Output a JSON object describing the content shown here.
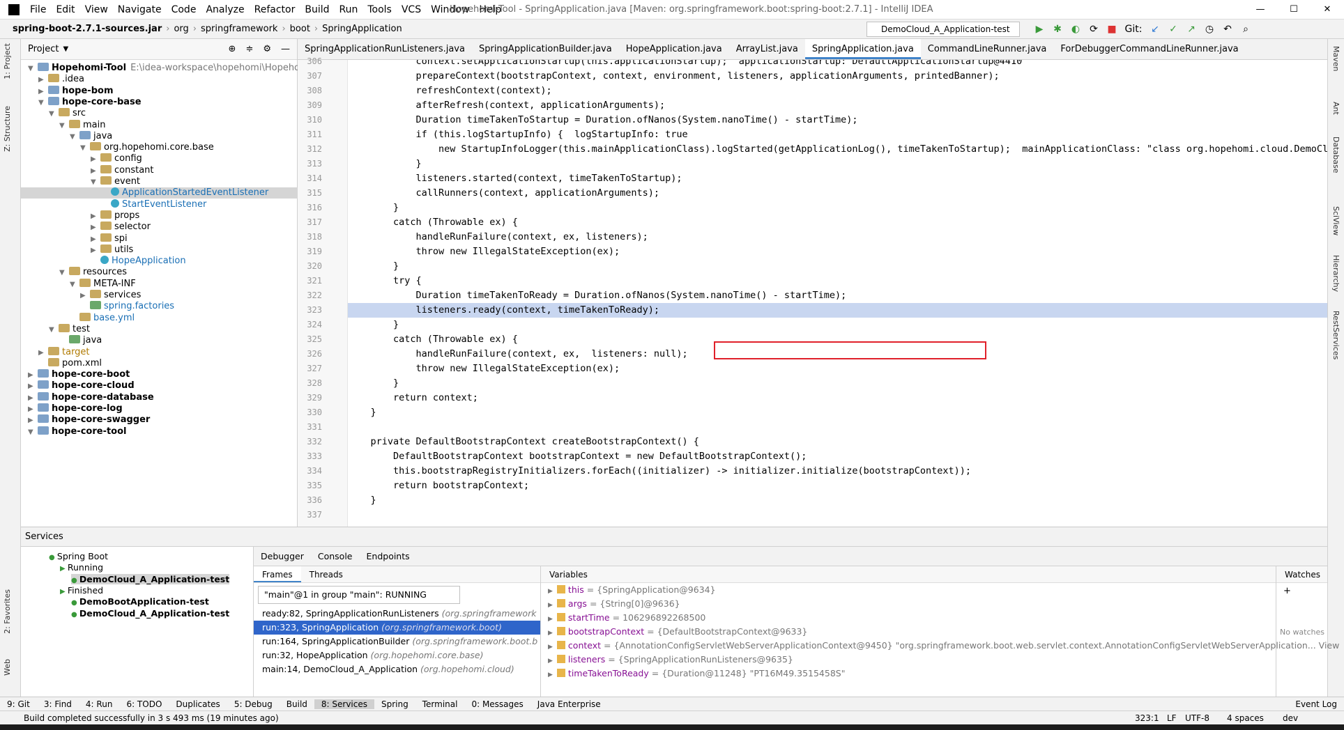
{
  "menu": [
    "File",
    "Edit",
    "View",
    "Navigate",
    "Code",
    "Analyze",
    "Refactor",
    "Build",
    "Run",
    "Tools",
    "VCS",
    "Window",
    "Help"
  ],
  "window_title": "Hopehomi-Tool - SpringApplication.java [Maven: org.springframework.boot:spring-boot:2.7.1] - IntelliJ IDEA",
  "breadcrumb": [
    "spring-boot-2.7.1-sources.jar",
    "org",
    "springframework",
    "boot",
    "SpringApplication"
  ],
  "run_config": "DemoCloud_A_Application-test",
  "git_label": "Git:",
  "left_tabs": [
    "1: Project",
    "Z: Structure",
    "2: Favorites",
    "Web"
  ],
  "right_tabs": [
    "Maven",
    "Ant",
    "Database",
    "SciView",
    "Hierarchy",
    "RestServices"
  ],
  "project": {
    "header": "Project",
    "nodes": [
      {
        "t": "Hopehomi-Tool",
        "extra": "E:\\idea-workspace\\hopehomi\\Hopehomi-To",
        "d": 0,
        "open": "v",
        "ic": "foldb",
        "b": true
      },
      {
        "t": ".idea",
        "d": 1,
        "open": ">",
        "ic": "fold"
      },
      {
        "t": "hope-bom",
        "d": 1,
        "open": ">",
        "ic": "foldb",
        "b": true
      },
      {
        "t": "hope-core-base",
        "d": 1,
        "open": "v",
        "ic": "foldb",
        "b": true
      },
      {
        "t": "src",
        "d": 2,
        "open": "v",
        "ic": "fold"
      },
      {
        "t": "main",
        "d": 3,
        "open": "v",
        "ic": "fold"
      },
      {
        "t": "java",
        "d": 4,
        "open": "v",
        "ic": "foldb"
      },
      {
        "t": "org.hopehomi.core.base",
        "d": 5,
        "open": "v",
        "ic": "fold"
      },
      {
        "t": "config",
        "d": 6,
        "open": ">",
        "ic": "fold"
      },
      {
        "t": "constant",
        "d": 6,
        "open": ">",
        "ic": "fold"
      },
      {
        "t": "event",
        "d": 6,
        "open": "v",
        "ic": "fold"
      },
      {
        "t": "ApplicationStartedEventListener",
        "d": 7,
        "open": "",
        "ic": "clsi",
        "c": "#1a6fb5",
        "sel": true
      },
      {
        "t": "StartEventListener",
        "d": 7,
        "open": "",
        "ic": "clsi",
        "c": "#1a6fb5"
      },
      {
        "t": "props",
        "d": 6,
        "open": ">",
        "ic": "fold"
      },
      {
        "t": "selector",
        "d": 6,
        "open": ">",
        "ic": "fold"
      },
      {
        "t": "spi",
        "d": 6,
        "open": ">",
        "ic": "fold"
      },
      {
        "t": "utils",
        "d": 6,
        "open": ">",
        "ic": "fold"
      },
      {
        "t": "HopeApplication",
        "d": 6,
        "open": "",
        "ic": "clsi",
        "c": "#1a6fb5"
      },
      {
        "t": "resources",
        "d": 3,
        "open": "v",
        "ic": "fold"
      },
      {
        "t": "META-INF",
        "d": 4,
        "open": "v",
        "ic": "fold"
      },
      {
        "t": "services",
        "d": 5,
        "open": ">",
        "ic": "fold"
      },
      {
        "t": "spring.factories",
        "d": 5,
        "open": "",
        "ic": "foldg",
        "c": "#1a6fb5"
      },
      {
        "t": "base.yml",
        "d": 4,
        "open": "",
        "ic": "fold",
        "c": "#1a6fb5"
      },
      {
        "t": "test",
        "d": 2,
        "open": "v",
        "ic": "fold"
      },
      {
        "t": "java",
        "d": 3,
        "open": "",
        "ic": "foldg"
      },
      {
        "t": "target",
        "d": 1,
        "open": ">",
        "ic": "fold",
        "c": "#b07a00"
      },
      {
        "t": "pom.xml",
        "d": 1,
        "open": "",
        "ic": "fold"
      },
      {
        "t": "hope-core-boot",
        "d": 0,
        "open": ">",
        "ic": "foldb",
        "b": true
      },
      {
        "t": "hope-core-cloud",
        "d": 0,
        "open": ">",
        "ic": "foldb",
        "b": true
      },
      {
        "t": "hope-core-database",
        "d": 0,
        "open": ">",
        "ic": "foldb",
        "b": true
      },
      {
        "t": "hope-core-log",
        "d": 0,
        "open": ">",
        "ic": "foldb",
        "b": true
      },
      {
        "t": "hope-core-swagger",
        "d": 0,
        "open": ">",
        "ic": "foldb",
        "b": true
      },
      {
        "t": "hope-core-tool",
        "d": 0,
        "open": "v",
        "ic": "foldb",
        "b": true
      }
    ]
  },
  "editor_tabs": [
    "SpringApplicationRunListeners.java",
    "SpringApplicationBuilder.java",
    "HopeApplication.java",
    "ArrayList.java",
    "SpringApplication.java",
    "CommandLineRunner.java",
    "ForDebuggerCommandLineRunner.java"
  ],
  "active_tab": 4,
  "code": [
    {
      "n": "306",
      "s": "            context.setApplicationStartup(this.applicationStartup);  applicationStartup: DefaultApplicationStartup@4410"
    },
    {
      "n": "307",
      "s": "            prepareContext(bootstrapContext, context, environment, listeners, applicationArguments, printedBanner);"
    },
    {
      "n": "308",
      "s": "            refreshContext(context);"
    },
    {
      "n": "309",
      "s": "            afterRefresh(context, applicationArguments);"
    },
    {
      "n": "310",
      "s": "            Duration timeTakenToStartup = Duration.ofNanos(System.nanoTime() - startTime);"
    },
    {
      "n": "311",
      "s": "            if (this.logStartupInfo) {  logStartupInfo: true"
    },
    {
      "n": "312",
      "s": "                new StartupInfoLogger(this.mainApplicationClass).logStarted(getApplicationLog(), timeTakenToStartup);  mainApplicationClass: \"class org.hopehomi.cloud.DemoCloud"
    },
    {
      "n": "313",
      "s": "            }"
    },
    {
      "n": "314",
      "s": "            listeners.started(context, timeTakenToStartup);"
    },
    {
      "n": "315",
      "s": "            callRunners(context, applicationArguments);"
    },
    {
      "n": "316",
      "s": "        }"
    },
    {
      "n": "317",
      "s": "        catch (Throwable ex) {"
    },
    {
      "n": "318",
      "s": "            handleRunFailure(context, ex, listeners);"
    },
    {
      "n": "319",
      "s": "            throw new IllegalStateException(ex);"
    },
    {
      "n": "320",
      "s": "        }"
    },
    {
      "n": "321",
      "s": "        try {"
    },
    {
      "n": "322",
      "s": "            Duration timeTakenToReady = Duration.ofNanos(System.nanoTime() - startTime);"
    },
    {
      "n": "323",
      "s": "            listeners.ready(context, timeTakenToReady);",
      "hl": true
    },
    {
      "n": "324",
      "s": "        }"
    },
    {
      "n": "325",
      "s": "        catch (Throwable ex) {"
    },
    {
      "n": "326",
      "s": "            handleRunFailure(context, ex,  listeners: null);"
    },
    {
      "n": "327",
      "s": "            throw new IllegalStateException(ex);"
    },
    {
      "n": "328",
      "s": "        }"
    },
    {
      "n": "329",
      "s": "        return context;"
    },
    {
      "n": "330",
      "s": "    }"
    },
    {
      "n": "331",
      "s": ""
    },
    {
      "n": "332",
      "s": "    private DefaultBootstrapContext createBootstrapContext() {"
    },
    {
      "n": "333",
      "s": "        DefaultBootstrapContext bootstrapContext = new DefaultBootstrapContext();"
    },
    {
      "n": "334",
      "s": "        this.bootstrapRegistryInitializers.forEach((initializer) -> initializer.initialize(bootstrapContext));"
    },
    {
      "n": "335",
      "s": "        return bootstrapContext;"
    },
    {
      "n": "336",
      "s": "    }"
    },
    {
      "n": "337",
      "s": ""
    }
  ],
  "services": {
    "header": "Services",
    "tree": [
      {
        "t": "Spring Boot",
        "d": 0,
        "b": false
      },
      {
        "t": "Running",
        "d": 1,
        "b": false
      },
      {
        "t": "DemoCloud_A_Application-test",
        "d": 2,
        "b": true,
        "sel": true
      },
      {
        "t": "Finished",
        "d": 1,
        "b": false
      },
      {
        "t": "DemoBootApplication-test",
        "d": 2,
        "b": true
      },
      {
        "t": "DemoCloud_A_Application-test",
        "d": 2,
        "b": true
      }
    ]
  },
  "debug_tabs": [
    "Debugger",
    "Console",
    "Endpoints"
  ],
  "frames_tabs": [
    "Frames",
    "Threads"
  ],
  "thread": "\"main\"@1 in group \"main\": RUNNING",
  "frames": [
    {
      "m": "ready:82, SpringApplicationRunListeners",
      "c": "(org.springframework"
    },
    {
      "m": "run:323, SpringApplication",
      "c": "(org.springframework.boot)",
      "sel": true
    },
    {
      "m": "run:164, SpringApplicationBuilder",
      "c": "(org.springframework.boot.b"
    },
    {
      "m": "run:32, HopeApplication",
      "c": "(org.hopehomi.core.base)"
    },
    {
      "m": "main:14, DemoCloud_A_Application",
      "c": "(org.hopehomi.cloud)"
    }
  ],
  "variables_header": "Variables",
  "variables": [
    {
      "n": "this",
      "v": "= {SpringApplication@9634}"
    },
    {
      "n": "args",
      "v": "= {String[0]@9636}"
    },
    {
      "n": "startTime",
      "v": "= 106296892268500"
    },
    {
      "n": "bootstrapContext",
      "v": "= {DefaultBootstrapContext@9633}"
    },
    {
      "n": "context",
      "v": "= {AnnotationConfigServletWebServerApplicationContext@9450} \"org.springframework.boot.web.servlet.context.AnnotationConfigServletWebServerApplication... View"
    },
    {
      "n": "listeners",
      "v": "= {SpringApplicationRunListeners@9635}"
    },
    {
      "n": "timeTakenToReady",
      "v": "= {Duration@11248} \"PT16M49.3515458S\""
    }
  ],
  "watches": {
    "header": "Watches",
    "empty": "No watches"
  },
  "bottom_tabs": [
    "9: Git",
    "3: Find",
    "4: Run",
    "6: TODO",
    "Duplicates",
    "5: Debug",
    "Build",
    "8: Services",
    "Spring",
    "Terminal",
    "0: Messages",
    "Java Enterprise",
    "Event Log"
  ],
  "status": {
    "msg": "Build completed successfully in 3 s 493 ms (19 minutes ago)",
    "pos": "323:1",
    "sep": "LF",
    "enc": "UTF-8",
    "indent": "4 spaces",
    "branch": "dev"
  }
}
